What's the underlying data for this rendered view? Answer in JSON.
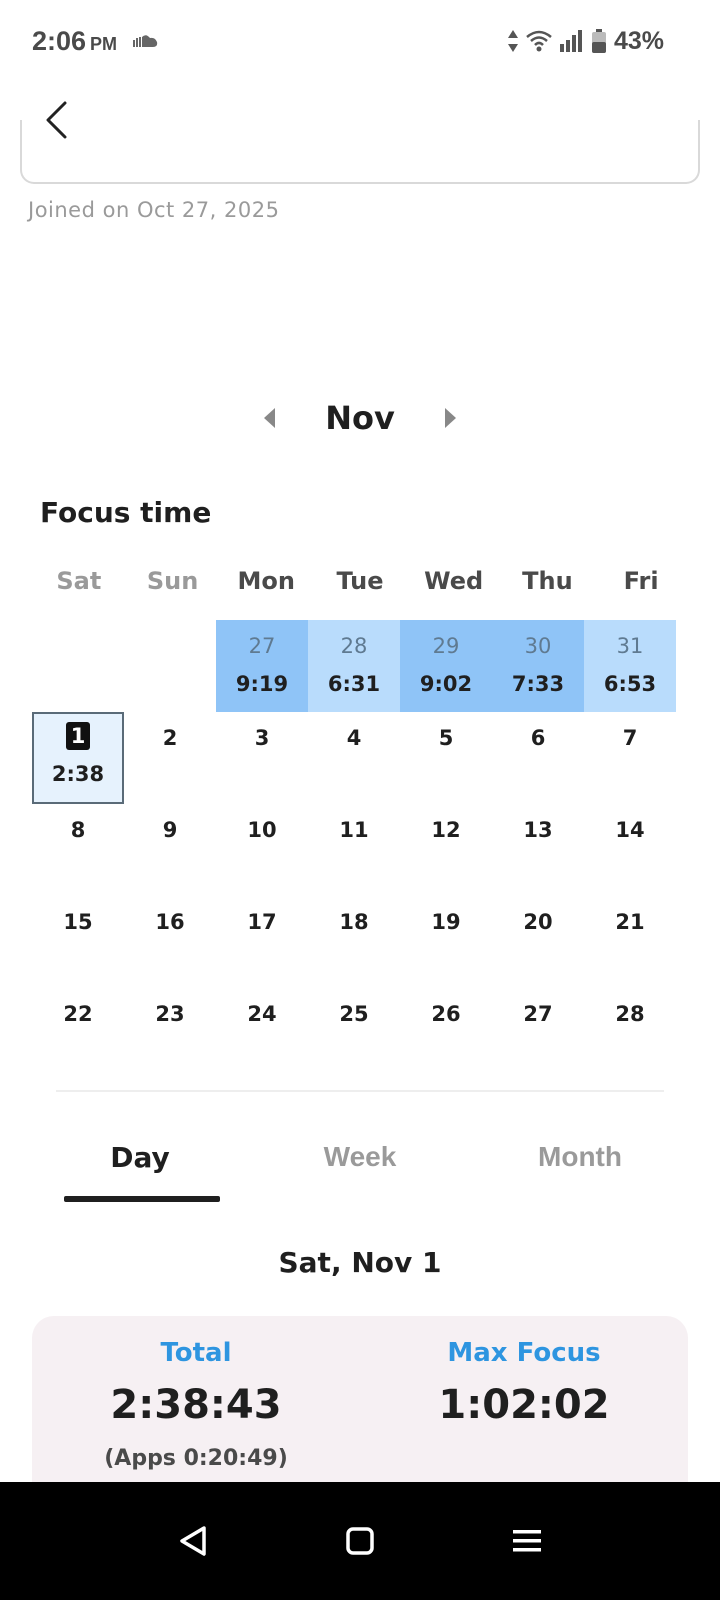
{
  "status_bar": {
    "time": "2:06",
    "ampm": "PM",
    "battery": "43%",
    "icons": [
      "soundcloud-icon",
      "data-arrows-icon",
      "wifi-icon",
      "signal-icon",
      "battery-icon"
    ]
  },
  "header": {
    "back_icon": "chevron-left-icon",
    "joined_text": "Joined on Oct 27, 2025"
  },
  "month_nav": {
    "label": "Nov",
    "prev_icon": "triangle-left-icon",
    "next_icon": "triangle-right-icon"
  },
  "section_title": "Focus time",
  "calendar": {
    "weekdays": [
      "Sat",
      "Sun",
      "Mon",
      "Tue",
      "Wed",
      "Thu",
      "Fri"
    ],
    "weeks": [
      [
        {
          "day": "",
          "dur": ""
        },
        {
          "day": "",
          "dur": ""
        },
        {
          "day": "27",
          "dur": "9:19",
          "past": true,
          "shade": "dark"
        },
        {
          "day": "28",
          "dur": "6:31",
          "past": true,
          "shade": "light"
        },
        {
          "day": "29",
          "dur": "9:02",
          "past": true,
          "shade": "dark"
        },
        {
          "day": "30",
          "dur": "7:33",
          "past": true,
          "shade": "dark"
        },
        {
          "day": "31",
          "dur": "6:53",
          "past": true,
          "shade": "light"
        }
      ],
      [
        {
          "day": "1",
          "dur": "2:38",
          "today": true
        },
        {
          "day": "2",
          "dur": ""
        },
        {
          "day": "3",
          "dur": ""
        },
        {
          "day": "4",
          "dur": ""
        },
        {
          "day": "5",
          "dur": ""
        },
        {
          "day": "6",
          "dur": ""
        },
        {
          "day": "7",
          "dur": ""
        }
      ],
      [
        {
          "day": "8",
          "dur": ""
        },
        {
          "day": "9",
          "dur": ""
        },
        {
          "day": "10",
          "dur": ""
        },
        {
          "day": "11",
          "dur": ""
        },
        {
          "day": "12",
          "dur": ""
        },
        {
          "day": "13",
          "dur": ""
        },
        {
          "day": "14",
          "dur": ""
        }
      ],
      [
        {
          "day": "15",
          "dur": ""
        },
        {
          "day": "16",
          "dur": ""
        },
        {
          "day": "17",
          "dur": ""
        },
        {
          "day": "18",
          "dur": ""
        },
        {
          "day": "19",
          "dur": ""
        },
        {
          "day": "20",
          "dur": ""
        },
        {
          "day": "21",
          "dur": ""
        }
      ],
      [
        {
          "day": "22",
          "dur": ""
        },
        {
          "day": "23",
          "dur": ""
        },
        {
          "day": "24",
          "dur": ""
        },
        {
          "day": "25",
          "dur": ""
        },
        {
          "day": "26",
          "dur": ""
        },
        {
          "day": "27",
          "dur": ""
        },
        {
          "day": "28",
          "dur": ""
        }
      ]
    ],
    "colors": {
      "dark": "#8fc4f7",
      "light": "#b9dcfc",
      "today_bg": "#e6f2fd"
    }
  },
  "tabs": [
    {
      "label": "Day",
      "active": true
    },
    {
      "label": "Week",
      "active": false
    },
    {
      "label": "Month",
      "active": false
    }
  ],
  "selected_date": "Sat, Nov 1",
  "stats": {
    "total_label": "Total",
    "total_value": "2:38:43",
    "apps_text": "(Apps 0:20:49)",
    "max_label": "Max Focus",
    "max_value": "1:02:02",
    "accent": "#2e95e0"
  },
  "nav_bar": {
    "icons": [
      "back-triangle-icon",
      "home-square-icon",
      "menu-lines-icon"
    ]
  }
}
